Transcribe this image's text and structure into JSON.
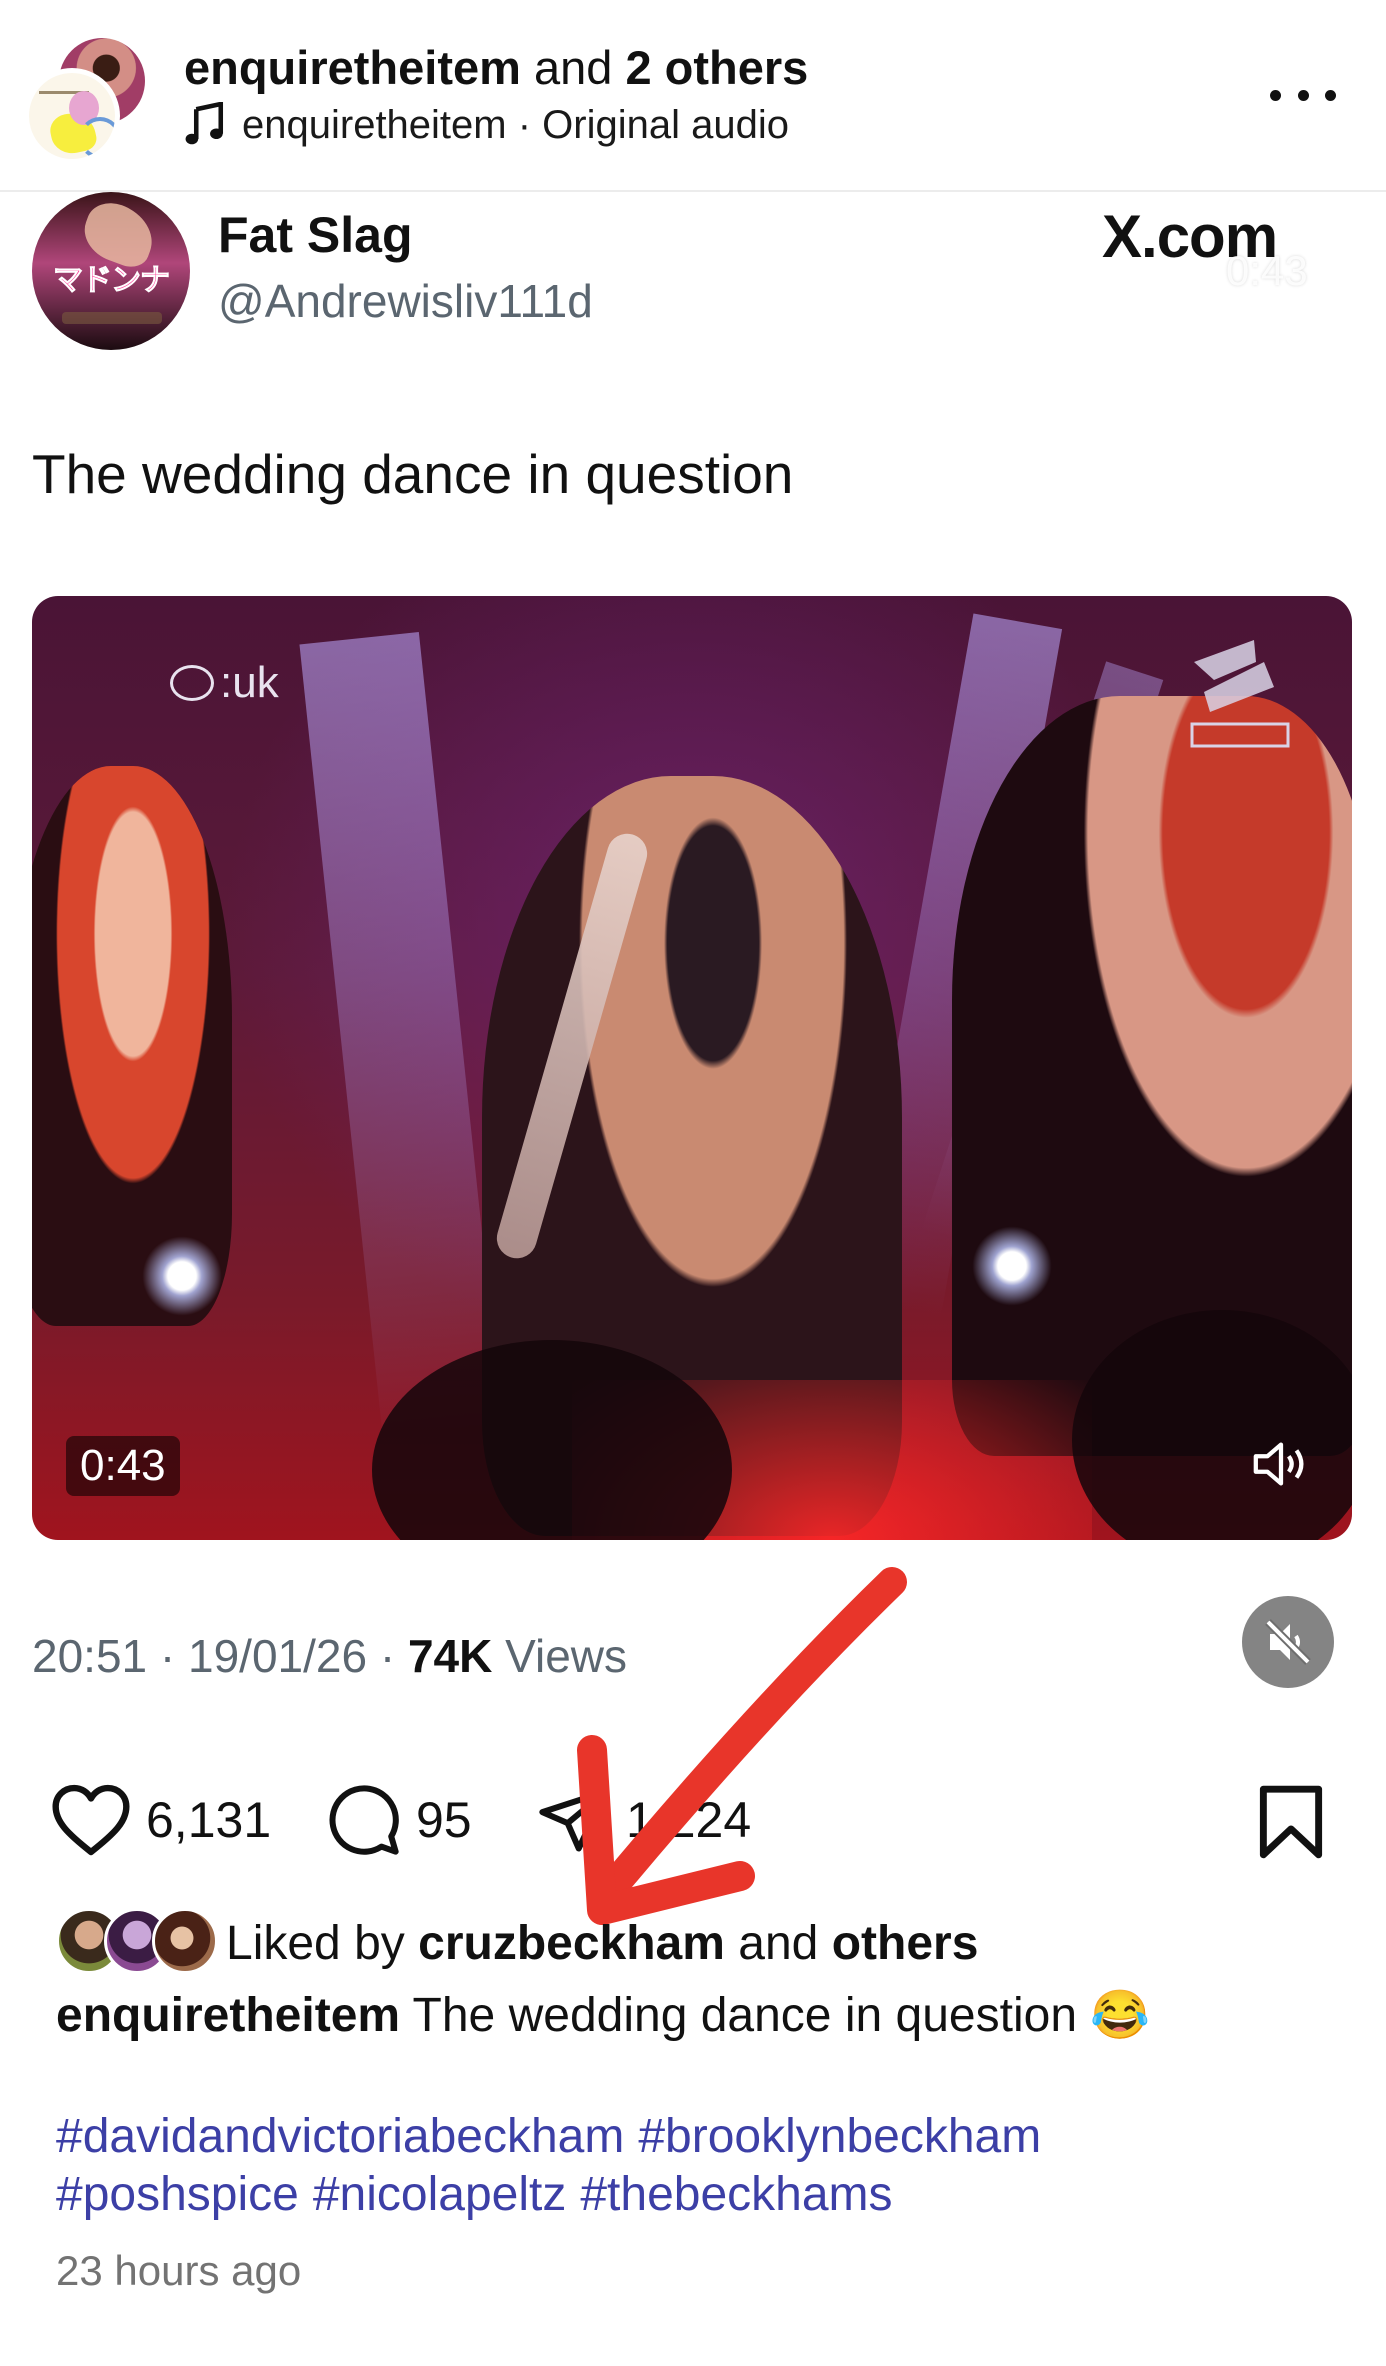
{
  "header": {
    "account": "enquiretheitem",
    "title_suffix_and": "and",
    "title_suffix_count": "2 others",
    "audio_account": "enquiretheitem",
    "audio_separator": " · ",
    "audio_label": "Original audio"
  },
  "tweet": {
    "display_name": "Fat Slag",
    "handle": "@Andrewisliv111d",
    "source": "X.com",
    "source_overlay": "0:43",
    "avatar_text": "マドンナ",
    "text": "The wedding dance in question",
    "video": {
      "channel_logo": ":uk",
      "duration": "0:43"
    },
    "time": "20:51",
    "date": "19/01/26",
    "views_count": "74K",
    "views_label": "Views",
    "dot": " · "
  },
  "actions": {
    "likes": "6,131",
    "comments": "95",
    "shares": "1,224"
  },
  "post": {
    "liked_prefix": "Liked by ",
    "liked_user": "cruzbeckham",
    "liked_and": " and ",
    "liked_others": "others",
    "caption_user": "enquiretheitem",
    "caption_text": " The wedding dance in question ",
    "caption_emoji": "😂",
    "hashtags": [
      "#davidandvictoriabeckham",
      "#brooklynbeckham",
      "#poshspice",
      "#nicolapeltz",
      "#thebeckhams"
    ],
    "time_ago": "23 hours ago"
  },
  "colors": {
    "hashtag": "#3c3fa6",
    "annotation_arrow": "#e8352a",
    "muted_text": "#5b6670"
  },
  "icons": [
    "music-note-icon",
    "more-icon",
    "heart-icon",
    "comment-icon",
    "send-icon",
    "bookmark-icon",
    "volume-icon",
    "mute-icon"
  ]
}
